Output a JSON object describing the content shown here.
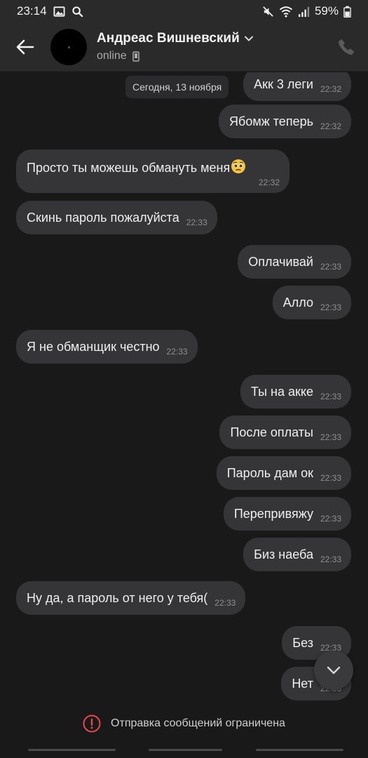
{
  "status_bar": {
    "time": "23:14",
    "battery": "59%"
  },
  "header": {
    "name": "Андреас Вишневский",
    "status": "online"
  },
  "date_chip": "Сегодня, 13 ноября",
  "messages": [
    {
      "dir": "out",
      "text": "Акк 3 леги",
      "time": "22:32"
    },
    {
      "dir": "out",
      "text": "Ябомж теперь",
      "time": "22:32"
    },
    {
      "dir": "in",
      "text": "Просто ты можешь обмануть меня",
      "time": "22:32",
      "emoji": "pleading-face"
    },
    {
      "dir": "in",
      "text": "Скинь пароль пожалуйста",
      "time": "22:33"
    },
    {
      "dir": "out",
      "text": "Оплачивай",
      "time": "22:33"
    },
    {
      "dir": "out",
      "text": "Алло",
      "time": "22:33"
    },
    {
      "dir": "in",
      "text": "Я не обманщик честно",
      "time": "22:33"
    },
    {
      "dir": "out",
      "text": "Ты на акке",
      "time": "22:33"
    },
    {
      "dir": "out",
      "text": "После оплаты",
      "time": "22:33"
    },
    {
      "dir": "out",
      "text": "Пароль дам ок",
      "time": "22:33"
    },
    {
      "dir": "out",
      "text": "Перепривяжу",
      "time": "22:33"
    },
    {
      "dir": "out",
      "text": "Биз наеба",
      "time": "22:33"
    },
    {
      "dir": "in",
      "text": "Ну да, а пароль от него у тебя(",
      "time": "22:33"
    },
    {
      "dir": "out",
      "text": "Без",
      "time": "22:33"
    },
    {
      "dir": "out",
      "text": "Нет",
      "time": "22:33"
    }
  ],
  "restriction_text": "Отправка сообщений ограничена",
  "colors": {
    "background": "#19191a",
    "bar": "#2a2a2b",
    "bubble": "#353537",
    "warning": "#e5484d"
  },
  "icons": {
    "back": "arrow-left-icon",
    "call": "phone-icon",
    "device": "mobile-device-icon",
    "dropdown": "chevron-down-icon",
    "scroll": "chevron-down-icon",
    "warning": "exclamation-circle-icon"
  }
}
